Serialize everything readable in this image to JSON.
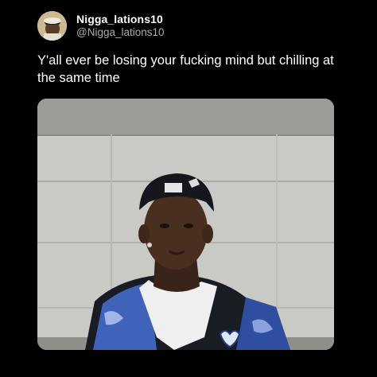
{
  "tweet": {
    "display_name": "Nigga_lations10",
    "handle": "@Nigga_lations10",
    "text": "Y'all ever be losing your fucking mind but chilling at the same time"
  },
  "icons": {
    "avatar": "profile-avatar",
    "media": "photo-of-man-in-cap-and-cardigan"
  },
  "colors": {
    "background": "#000000",
    "text_primary": "#ffffff",
    "text_secondary": "#a7adb2"
  }
}
